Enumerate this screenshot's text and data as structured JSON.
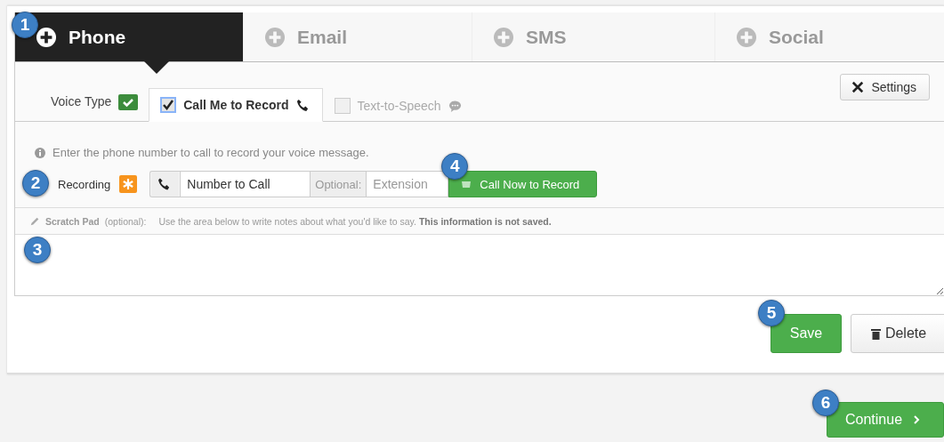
{
  "channel_tabs": [
    {
      "label": "Phone",
      "selected": true,
      "badge": "1"
    },
    {
      "label": "Email",
      "selected": false
    },
    {
      "label": "SMS",
      "selected": false
    },
    {
      "label": "Social",
      "selected": false
    }
  ],
  "voice_type": {
    "label": "Voice Type",
    "options": [
      {
        "label": "Call Me to Record",
        "selected": true,
        "checked": true,
        "kind": "phone"
      },
      {
        "label": "Text-to-Speech",
        "selected": false,
        "checked": false,
        "kind": "chat"
      }
    ]
  },
  "settings_button": "Settings",
  "info": "Enter the phone number to call to record your voice message.",
  "recording": {
    "label": "Recording",
    "badge": "2",
    "number_placeholder": "Number to Call",
    "optional_label": "Optional:",
    "extension_placeholder": "Extension",
    "call_button": "Call Now to Record",
    "call_badge": "4"
  },
  "scratch_pad": {
    "title": "Scratch Pad",
    "note": "(optional):",
    "text": "Use the area below to write notes about what you'd like to say. **This information is not saved.**",
    "badge": "3"
  },
  "actions": {
    "save": "Save",
    "save_badge": "5",
    "delete": "Delete"
  },
  "continue": {
    "label": "Continue",
    "badge": "6"
  }
}
